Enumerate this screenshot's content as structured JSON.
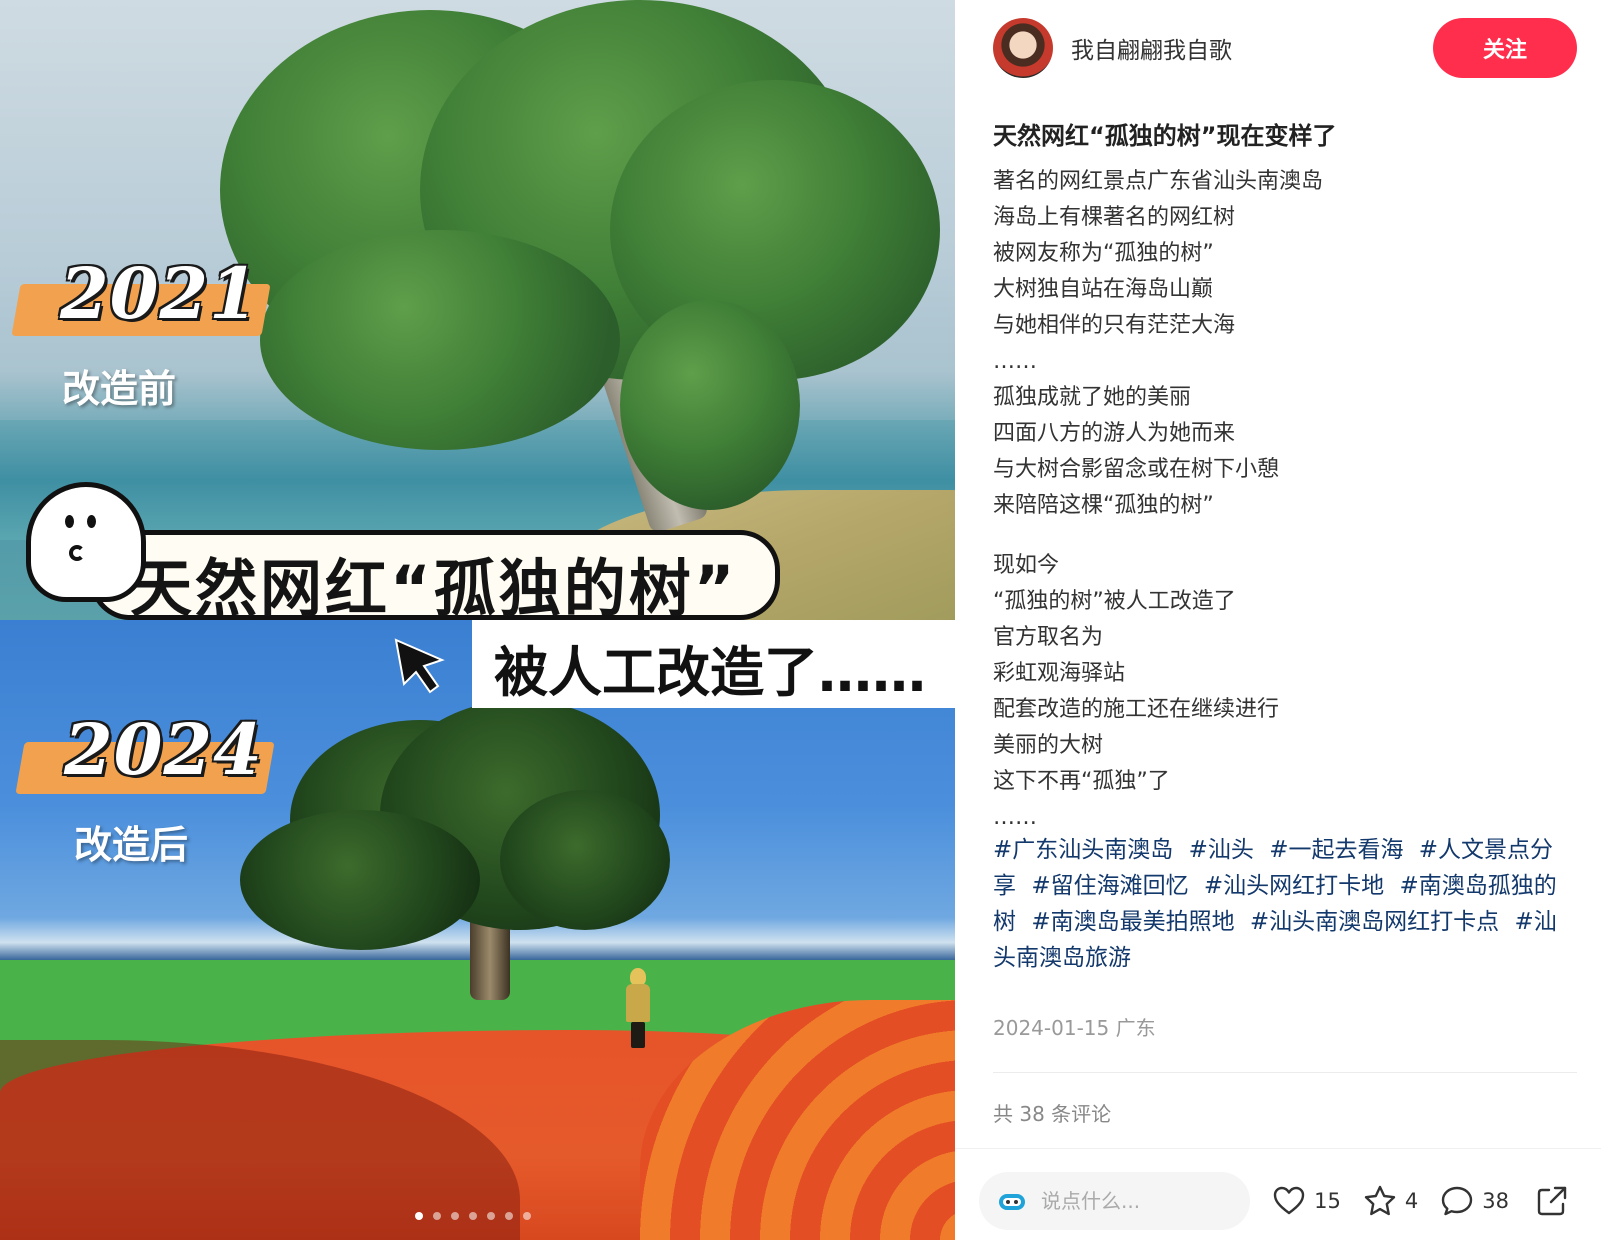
{
  "media": {
    "top": {
      "year": "2021",
      "subtitle": "改造前"
    },
    "bottom": {
      "year": "2024",
      "subtitle": "改造后"
    },
    "bubble_text": "天然网红“孤独的树”",
    "caption": "被人工改造了……",
    "carousel": {
      "count": 7,
      "active_index": 0
    }
  },
  "author": {
    "name": "我自翩翩我自歌",
    "follow_label": "关注"
  },
  "post": {
    "title": "天然网红“孤独的树”现在变样了",
    "lines": [
      "著名的网红景点广东省汕头南澳岛",
      "海岛上有棵著名的网红树",
      "被网友称为“孤独的树”",
      "大树独自站在海岛山巅",
      "与她相伴的只有茫茫大海",
      "……",
      "孤独成就了她的美丽",
      "四面八方的游人为她而来",
      "与大树合影留念或在树下小憩",
      "来陪陪这棵“孤独的树”",
      "",
      "现如今",
      "“孤独的树”被人工改造了",
      "官方取名为",
      "彩虹观海驿站",
      "配套改造的施工还在继续进行",
      "美丽的大树",
      "这下不再“孤独”了",
      "……"
    ],
    "tags": [
      "#广东汕头南澳岛",
      "#汕头",
      "#一起去看海",
      "#人文景点分享",
      "#留住海滩回忆",
      "#汕头网红打卡地",
      "#南澳岛孤独的树",
      "#南澳岛最美拍照地",
      "#汕头南澳岛网红打卡点",
      "#汕头南澳岛旅游"
    ],
    "date": "2024-01-15",
    "location": "广东",
    "comment_total": "共 38 条评论"
  },
  "bottom_bar": {
    "comment_placeholder": "说点什么...",
    "likes": "15",
    "collects": "4",
    "comments": "38"
  },
  "colors": {
    "follow": "#ff2e4d",
    "tag": "#13386c",
    "year_bg": "#f2a24f"
  },
  "icons": [
    "heart-icon",
    "star-icon",
    "comment-bubble-icon",
    "share-icon",
    "cursor-arrow-icon",
    "ghost-icon",
    "avatar-sticker-icon"
  ]
}
